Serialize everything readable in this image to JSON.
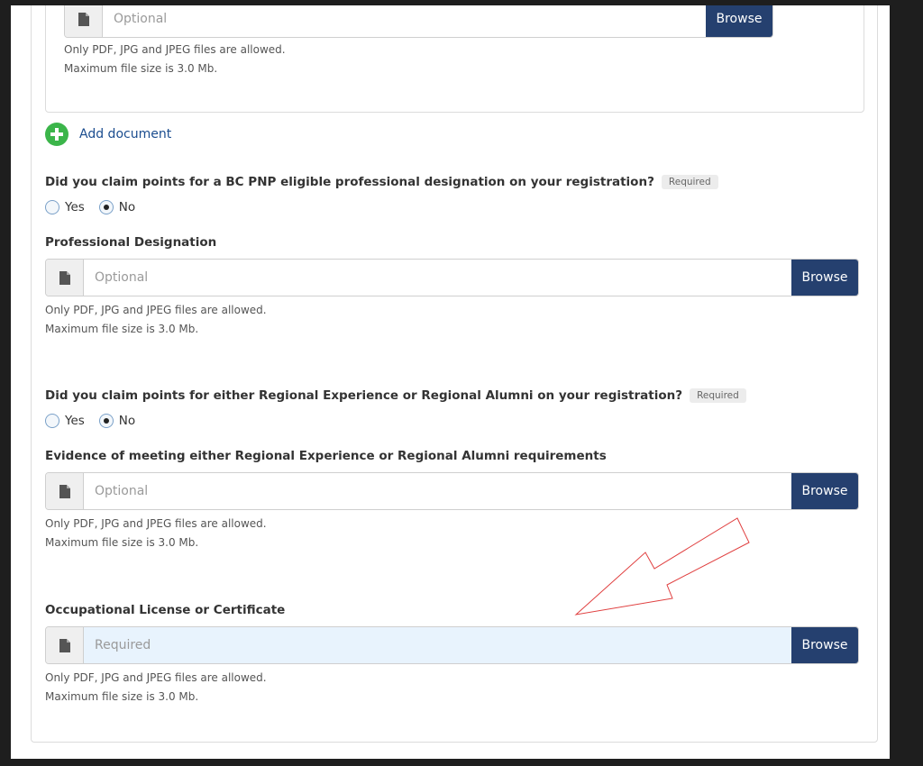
{
  "colors": {
    "browse": "#25406f",
    "add_icon": "#3bb54a",
    "link": "#1b4d8f",
    "required_bg": "#e8f3fd",
    "annotation_arrow": "#e04040"
  },
  "top_upload": {
    "placeholder": "Optional",
    "browse_label": "Browse",
    "help_line1": "Only PDF, JPG and JPEG files are allowed.",
    "help_line2": "Maximum file size is 3.0 Mb."
  },
  "add_document": {
    "label": "Add document",
    "icon": "plus-circle-icon"
  },
  "q_professional": {
    "question": "Did you claim points for a BC PNP eligible professional designation on your registration?",
    "badge": "Required",
    "options": [
      "Yes",
      "No"
    ],
    "selected": "No"
  },
  "professional_designation": {
    "label": "Professional Designation",
    "placeholder": "Optional",
    "browse_label": "Browse",
    "help_line1": "Only PDF, JPG and JPEG files are allowed.",
    "help_line2": "Maximum file size is 3.0 Mb."
  },
  "q_regional": {
    "question": "Did you claim points for either Regional Experience or Regional Alumni on your registration?",
    "badge": "Required",
    "options": [
      "Yes",
      "No"
    ],
    "selected": "No"
  },
  "regional_evidence": {
    "label": "Evidence of meeting either Regional Experience or Regional Alumni requirements",
    "placeholder": "Optional",
    "browse_label": "Browse",
    "help_line1": "Only PDF, JPG and JPEG files are allowed.",
    "help_line2": "Maximum file size is 3.0 Mb."
  },
  "occupational_license": {
    "label": "Occupational License or Certificate",
    "placeholder": "Required",
    "browse_label": "Browse",
    "help_line1": "Only PDF, JPG and JPEG files are allowed.",
    "help_line2": "Maximum file size is 3.0 Mb."
  }
}
